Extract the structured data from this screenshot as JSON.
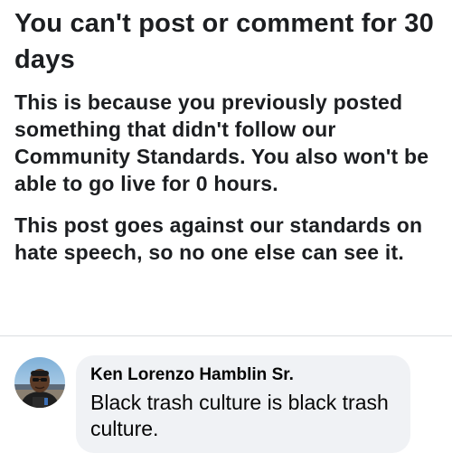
{
  "notice": {
    "title": "You can't post or comment for 30 days",
    "reason": "This is because you previously posted something that didn't follow our Community Standards.  You also won't be able to go  live for 0 hours.",
    "detail": "This post goes against our standards on hate speech, so no one else can see it."
  },
  "comment": {
    "author": "Ken Lorenzo Hamblin Sr.",
    "text": "Black trash culture is black trash culture.",
    "avatar_icon": "profile-photo-avatar",
    "bubble_color": "#f0f2f5"
  }
}
